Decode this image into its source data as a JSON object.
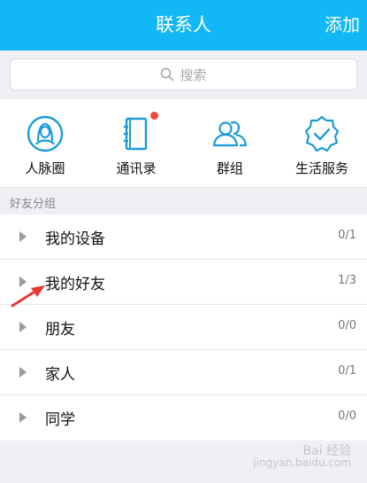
{
  "header": {
    "title": "联系人",
    "add_label": "添加"
  },
  "search": {
    "placeholder": "搜索",
    "icon": "search-icon"
  },
  "quick_actions": [
    {
      "label": "人脉圈",
      "icon": "person-circle-icon",
      "badge": false
    },
    {
      "label": "通讯录",
      "icon": "address-book-icon",
      "badge": true
    },
    {
      "label": "群组",
      "icon": "group-icon",
      "badge": false
    },
    {
      "label": "生活服务",
      "icon": "badge-check-icon",
      "badge": false
    }
  ],
  "groups_title": "好友分组",
  "groups": [
    {
      "name": "我的设备",
      "count": "0/1"
    },
    {
      "name": "我的好友",
      "count": "1/3"
    },
    {
      "name": "朋友",
      "count": "0/0"
    },
    {
      "name": "家人",
      "count": "0/1"
    },
    {
      "name": "同学",
      "count": "0/0"
    }
  ],
  "watermark": {
    "line1": "Bai 经验",
    "line2": "jingyan.baidu.com"
  },
  "colors": {
    "header": "#12b7f5",
    "icon": "#1a9bd7",
    "badge": "#f3463c",
    "arrow": "#e53935"
  }
}
